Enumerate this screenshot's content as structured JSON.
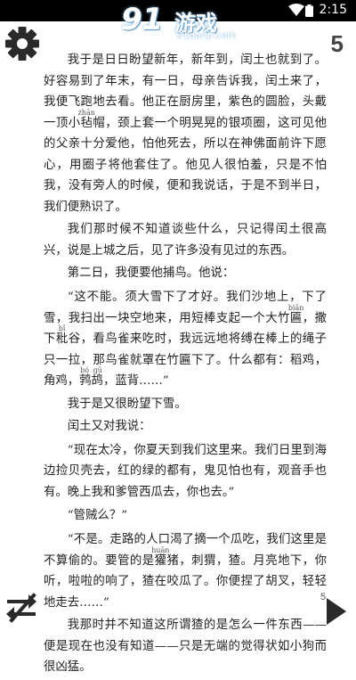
{
  "status_bar": {
    "time": "2:15"
  },
  "watermark": {
    "logo_num": "91",
    "logo_cn": "游戏",
    "url": "91danji.com"
  },
  "header": {
    "page_number": "5"
  },
  "footer": {
    "page_number": "5"
  },
  "icons": {
    "settings": "gear-icon",
    "swap": "swap-arrows-icon",
    "next": "play-triangle-icon"
  },
  "story": {
    "p1": {
      "a": "我于是日日盼望新年，新年到，闰土也就到了。好容易到了年末，有一日，母亲告诉我，闰土来了，我便飞跑地去看。他正在厨房里，紫色的圆脸，头戴一顶小",
      "b_base": "毡",
      "b_pinyin": "zhān",
      "c": "帽，颈上套一个明晃晃的银项圈，这可见他的父亲十分爱他，怕他死去，所以在神佛面前许下愿心，用圈子将他套住了。他见人很怕羞，只是不怕我，没有旁人的时候，便和我说话，于是不到半日，我们便熟识了。"
    },
    "p2": "我们那时候不知道谈些什么，只记得闰土很高兴，说是上城之后，见了许多没有见过的东西。",
    "p3": "第二日，我便要他捕鸟。他说：",
    "p4": {
      "a": "“这不能。须大雪下了才好。我们沙地上，下了雪，我扫出一块空地来，用短棒支起一个大竹",
      "b_base": "匾",
      "b_pinyin": "biǎn",
      "c": "，撒下",
      "d_base": "秕",
      "d_pinyin": "bǐ",
      "e": "谷，看鸟雀来吃时，我远远地将缚在棒上的绳子只一拉，那鸟雀就罩在竹匾下了。什么都有：稻鸡，角鸡，",
      "f_base": "鹁鸪",
      "f_pinyin": "bó gū",
      "g": "，蓝背……”"
    },
    "p5": "我于是又很盼望下雪。",
    "p6": "闰土又对我说：",
    "p7": "“现在太冷，你夏天到我们这里来。我们日里到海边捡贝壳去，红的绿的都有，鬼见怕也有，观音手也有。晚上我和爹管西瓜去，你也去。”",
    "p8": "“管贼么？”",
    "p9": {
      "a": "“不是。走路的人口渴了摘一个瓜吃，我们这里是不算偷的。要管的是",
      "b_base": "獾",
      "b_pinyin": "huān",
      "c": "猪，刺猬，猹。月亮地下，你听，啦啦的响了，猹在咬瓜了。你便捏了胡叉，轻轻地走去……”"
    },
    "p10": "我那时并不知道这所谓猹的是怎么一件东西——便是现在也没有知道——只是无端的觉得状如小狗而很凶猛。"
  }
}
